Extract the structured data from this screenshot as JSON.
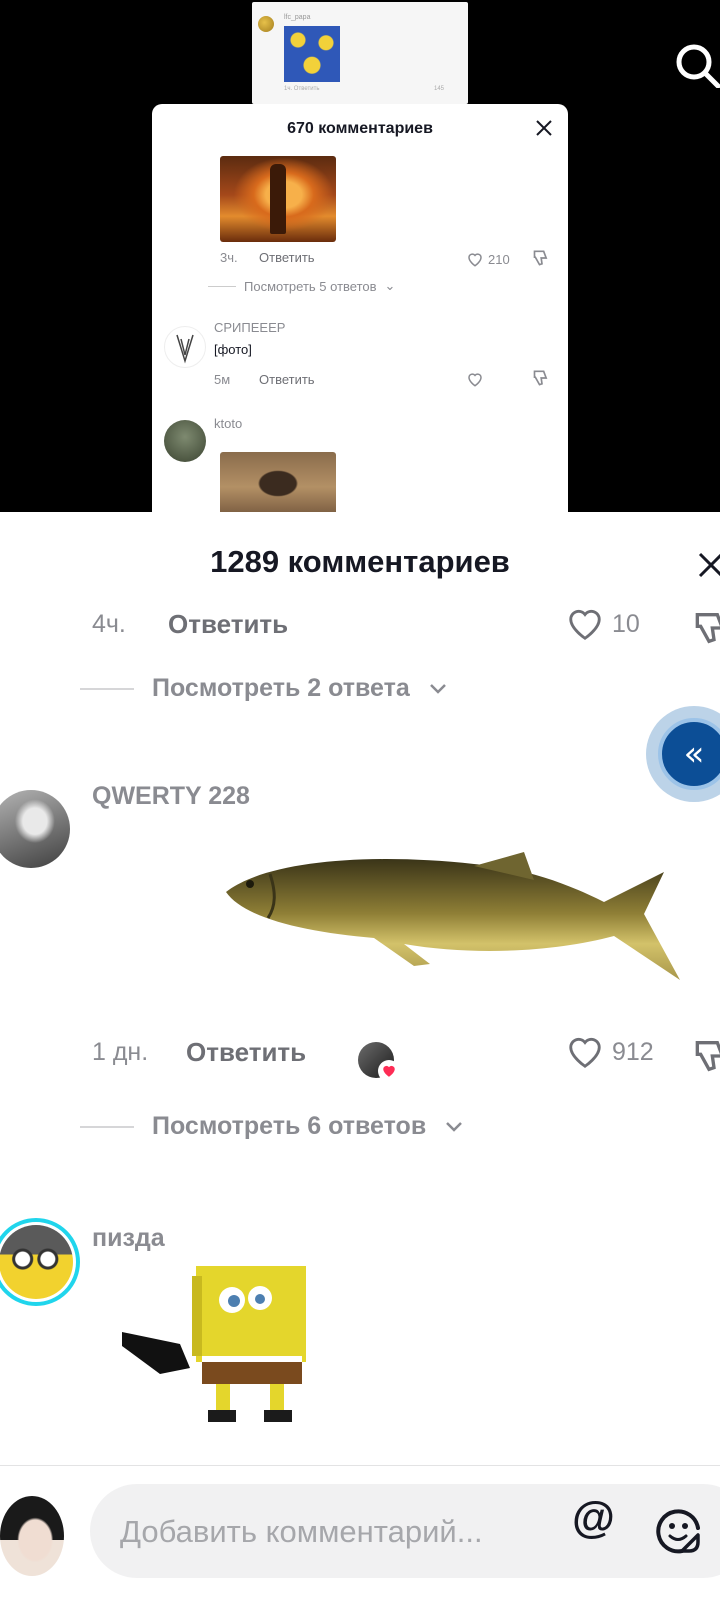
{
  "background_card": {
    "mini_name": "lfc_papa",
    "mini_meta": "1ч.   Ответить",
    "mini_likes": "145",
    "title": "670 комментариев",
    "comment1": {
      "time": "3ч.",
      "reply_label": "Ответить",
      "likes": "210"
    },
    "view_more": "Посмотреть 5 ответов",
    "comment2": {
      "author": "СРИПЕЕЕР",
      "text": "[фото]",
      "time": "5м",
      "reply_label": "Ответить"
    },
    "comment3": {
      "author": "ktoto"
    }
  },
  "sheet": {
    "title": "1289 комментариев"
  },
  "comments": [
    {
      "time": "4ч.",
      "reply_label": "Ответить",
      "likes": "10",
      "view_more": "Посмотреть 2 ответа"
    },
    {
      "author": "QWERTY 228",
      "time": "1 дн.",
      "reply_label": "Ответить",
      "likes": "912",
      "view_more": "Посмотреть 6 ответов"
    },
    {
      "author": "пизда"
    }
  ],
  "composer": {
    "placeholder": "Добавить комментарий...",
    "mention_symbol": "@"
  },
  "icons": {
    "floating": "«"
  },
  "colors": {
    "accent_ring": "#20d5ec",
    "floating_button": "#0c4e96",
    "heart_red": "#fe2c55"
  }
}
